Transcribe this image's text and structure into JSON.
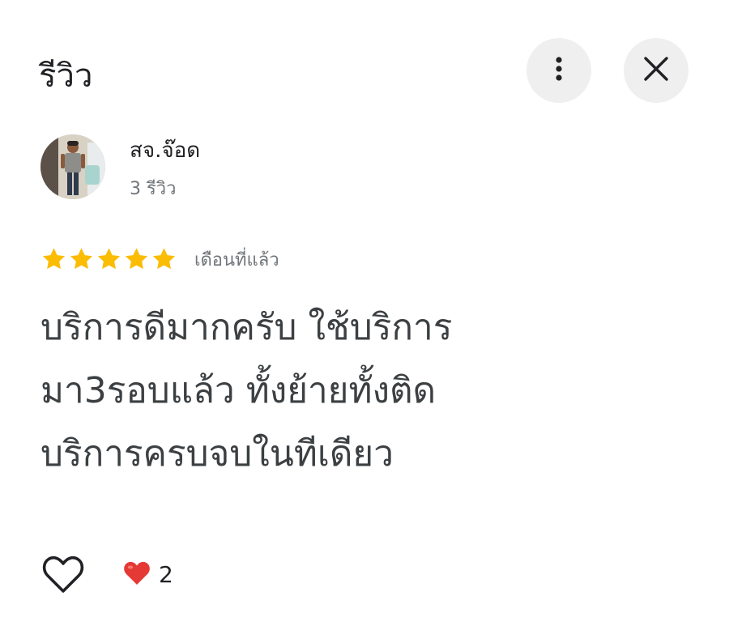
{
  "header": {
    "title": "รีวิว",
    "more_icon": "more-vert-icon",
    "close_icon": "close-icon"
  },
  "reviewer": {
    "name": "สจ.จ๊อด",
    "review_count": "3 รีวิว"
  },
  "review": {
    "rating": 5,
    "max_rating": 5,
    "date": "เดือนที่แล้ว",
    "lines": [
      "บริการดีมากครับ ใช้บริการ",
      "มา3รอบแล้ว ทั้งย้ายทั้งติด",
      "บริการครบจบในทีเดียว"
    ]
  },
  "actions": {
    "like_icon": "heart-outline-icon",
    "reaction_icon": "red-heart-icon",
    "reaction_count": "2"
  },
  "colors": {
    "star": "#fbbc04",
    "heart": "#e53935",
    "button_bg": "#efefef",
    "muted_text": "#70757a"
  }
}
